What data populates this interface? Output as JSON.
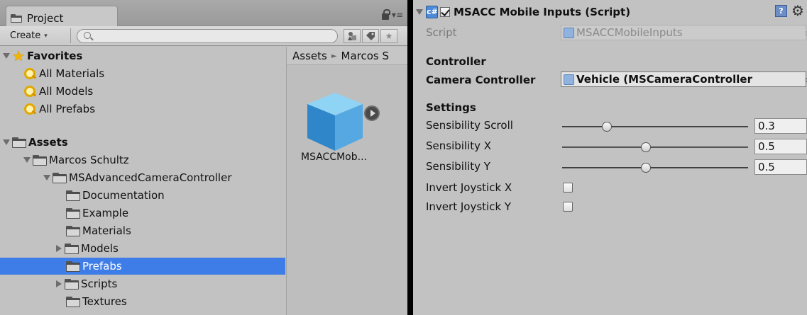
{
  "project_panel": {
    "tab_title": "Project",
    "create_label": "Create",
    "create_arrow": "▾",
    "search_placeholder": "",
    "tab_menu_glyph": "▾≡",
    "favorites": {
      "label": "Favorites",
      "items": [
        "All Materials",
        "All Models",
        "All Prefabs"
      ]
    },
    "assets": {
      "label": "Assets",
      "tree": [
        {
          "label": "Marcos Schultz",
          "level": 1
        },
        {
          "label": "MSAdvancedCameraController",
          "level": 2
        },
        {
          "label": "Documentation",
          "level": 3
        },
        {
          "label": "Example",
          "level": 3
        },
        {
          "label": "Materials",
          "level": 3
        },
        {
          "label": "Models",
          "level": 3
        },
        {
          "label": "Prefabs",
          "level": 3,
          "selected": true
        },
        {
          "label": "Scripts",
          "level": 3
        },
        {
          "label": "Textures",
          "level": 3
        }
      ]
    },
    "breadcrumb": [
      "Assets",
      "Marcos S"
    ],
    "breadcrumb_sep": "►",
    "asset_item": {
      "label": "MSACCMob..."
    }
  },
  "inspector": {
    "component_title": "MSACC Mobile Inputs (Script)",
    "script_icon_glyph": "c#",
    "help_glyph": "?",
    "gear_glyph": "⚙",
    "picker_glyph": "⊙",
    "script_label": "Script",
    "script_value": "MSACCMobileInputs",
    "controller_header": "Controller",
    "camera_controller_label": "Camera Controller",
    "camera_controller_value": "Vehicle (MSCameraController",
    "settings_header": "Settings",
    "sliders": [
      {
        "label": "Sensibility Scroll",
        "value": "0.3",
        "fraction": 0.24
      },
      {
        "label": "Sensibility X",
        "value": "0.5",
        "fraction": 0.45
      },
      {
        "label": "Sensibility Y",
        "value": "0.5",
        "fraction": 0.45
      }
    ],
    "toggles": [
      {
        "label": "Invert Joystick X",
        "checked": false
      },
      {
        "label": "Invert Joystick Y",
        "checked": false
      }
    ]
  },
  "colors": {
    "selection": "#3e7de7",
    "panel_bg": "#c2c2c2",
    "divider": "#000000"
  }
}
